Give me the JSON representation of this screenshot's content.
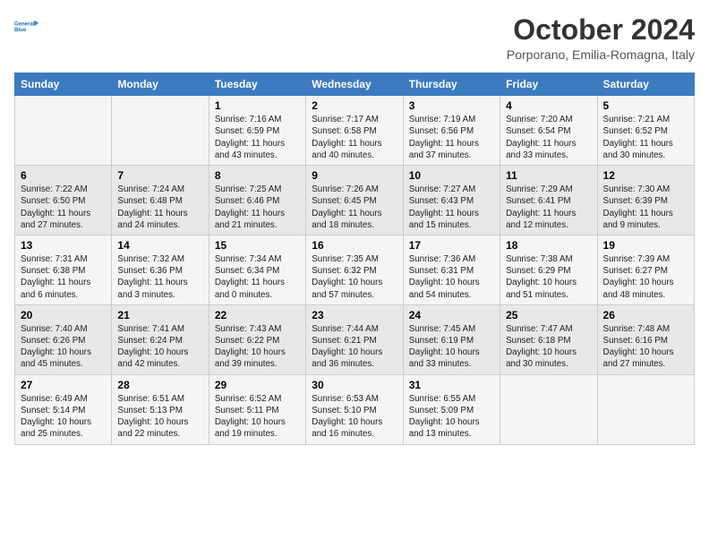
{
  "logo": {
    "line1": "General",
    "line2": "Blue"
  },
  "title": "October 2024",
  "location": "Porporano, Emilia-Romagna, Italy",
  "weekdays": [
    "Sunday",
    "Monday",
    "Tuesday",
    "Wednesday",
    "Thursday",
    "Friday",
    "Saturday"
  ],
  "rows": [
    [
      {
        "day": "",
        "info": ""
      },
      {
        "day": "",
        "info": ""
      },
      {
        "day": "1",
        "info": "Sunrise: 7:16 AM\nSunset: 6:59 PM\nDaylight: 11 hours and 43 minutes."
      },
      {
        "day": "2",
        "info": "Sunrise: 7:17 AM\nSunset: 6:58 PM\nDaylight: 11 hours and 40 minutes."
      },
      {
        "day": "3",
        "info": "Sunrise: 7:19 AM\nSunset: 6:56 PM\nDaylight: 11 hours and 37 minutes."
      },
      {
        "day": "4",
        "info": "Sunrise: 7:20 AM\nSunset: 6:54 PM\nDaylight: 11 hours and 33 minutes."
      },
      {
        "day": "5",
        "info": "Sunrise: 7:21 AM\nSunset: 6:52 PM\nDaylight: 11 hours and 30 minutes."
      }
    ],
    [
      {
        "day": "6",
        "info": "Sunrise: 7:22 AM\nSunset: 6:50 PM\nDaylight: 11 hours and 27 minutes."
      },
      {
        "day": "7",
        "info": "Sunrise: 7:24 AM\nSunset: 6:48 PM\nDaylight: 11 hours and 24 minutes."
      },
      {
        "day": "8",
        "info": "Sunrise: 7:25 AM\nSunset: 6:46 PM\nDaylight: 11 hours and 21 minutes."
      },
      {
        "day": "9",
        "info": "Sunrise: 7:26 AM\nSunset: 6:45 PM\nDaylight: 11 hours and 18 minutes."
      },
      {
        "day": "10",
        "info": "Sunrise: 7:27 AM\nSunset: 6:43 PM\nDaylight: 11 hours and 15 minutes."
      },
      {
        "day": "11",
        "info": "Sunrise: 7:29 AM\nSunset: 6:41 PM\nDaylight: 11 hours and 12 minutes."
      },
      {
        "day": "12",
        "info": "Sunrise: 7:30 AM\nSunset: 6:39 PM\nDaylight: 11 hours and 9 minutes."
      }
    ],
    [
      {
        "day": "13",
        "info": "Sunrise: 7:31 AM\nSunset: 6:38 PM\nDaylight: 11 hours and 6 minutes."
      },
      {
        "day": "14",
        "info": "Sunrise: 7:32 AM\nSunset: 6:36 PM\nDaylight: 11 hours and 3 minutes."
      },
      {
        "day": "15",
        "info": "Sunrise: 7:34 AM\nSunset: 6:34 PM\nDaylight: 11 hours and 0 minutes."
      },
      {
        "day": "16",
        "info": "Sunrise: 7:35 AM\nSunset: 6:32 PM\nDaylight: 10 hours and 57 minutes."
      },
      {
        "day": "17",
        "info": "Sunrise: 7:36 AM\nSunset: 6:31 PM\nDaylight: 10 hours and 54 minutes."
      },
      {
        "day": "18",
        "info": "Sunrise: 7:38 AM\nSunset: 6:29 PM\nDaylight: 10 hours and 51 minutes."
      },
      {
        "day": "19",
        "info": "Sunrise: 7:39 AM\nSunset: 6:27 PM\nDaylight: 10 hours and 48 minutes."
      }
    ],
    [
      {
        "day": "20",
        "info": "Sunrise: 7:40 AM\nSunset: 6:26 PM\nDaylight: 10 hours and 45 minutes."
      },
      {
        "day": "21",
        "info": "Sunrise: 7:41 AM\nSunset: 6:24 PM\nDaylight: 10 hours and 42 minutes."
      },
      {
        "day": "22",
        "info": "Sunrise: 7:43 AM\nSunset: 6:22 PM\nDaylight: 10 hours and 39 minutes."
      },
      {
        "day": "23",
        "info": "Sunrise: 7:44 AM\nSunset: 6:21 PM\nDaylight: 10 hours and 36 minutes."
      },
      {
        "day": "24",
        "info": "Sunrise: 7:45 AM\nSunset: 6:19 PM\nDaylight: 10 hours and 33 minutes."
      },
      {
        "day": "25",
        "info": "Sunrise: 7:47 AM\nSunset: 6:18 PM\nDaylight: 10 hours and 30 minutes."
      },
      {
        "day": "26",
        "info": "Sunrise: 7:48 AM\nSunset: 6:16 PM\nDaylight: 10 hours and 27 minutes."
      }
    ],
    [
      {
        "day": "27",
        "info": "Sunrise: 6:49 AM\nSunset: 5:14 PM\nDaylight: 10 hours and 25 minutes."
      },
      {
        "day": "28",
        "info": "Sunrise: 6:51 AM\nSunset: 5:13 PM\nDaylight: 10 hours and 22 minutes."
      },
      {
        "day": "29",
        "info": "Sunrise: 6:52 AM\nSunset: 5:11 PM\nDaylight: 10 hours and 19 minutes."
      },
      {
        "day": "30",
        "info": "Sunrise: 6:53 AM\nSunset: 5:10 PM\nDaylight: 10 hours and 16 minutes."
      },
      {
        "day": "31",
        "info": "Sunrise: 6:55 AM\nSunset: 5:09 PM\nDaylight: 10 hours and 13 minutes."
      },
      {
        "day": "",
        "info": ""
      },
      {
        "day": "",
        "info": ""
      }
    ]
  ]
}
